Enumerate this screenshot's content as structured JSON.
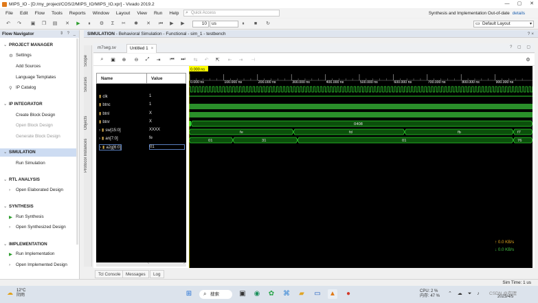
{
  "window": {
    "title": "MIPS_IO - [D:/my_project/COS/2/MIPS_IO/MIPS_IO.xpr] - Vivado 2019.2",
    "controls": [
      "—",
      "▢",
      "✕"
    ]
  },
  "menubar": {
    "items": [
      "File",
      "Edit",
      "Flow",
      "Tools",
      "Reports",
      "Window",
      "Layout",
      "View",
      "Run",
      "Help"
    ],
    "quick_access_placeholder": "Quick Access"
  },
  "status": {
    "text": "Synthesis and Implementation Out-of-date",
    "details_link": "details"
  },
  "toolbar": {
    "run_time_value": "10",
    "run_time_unit": "us",
    "layout_select": "Default Layout"
  },
  "flow_navigator": {
    "title": "Flow Navigator",
    "header_icons": "⇕ ? _",
    "sections": {
      "project_manager": "PROJECT MANAGER",
      "ip_integrator": "IP INTEGRATOR",
      "simulation": "SIMULATION",
      "rtl_analysis": "RTL ANALYSIS",
      "synthesis": "SYNTHESIS",
      "implementation": "IMPLEMENTATION"
    },
    "items": {
      "settings": "Settings",
      "add_sources": "Add Sources",
      "language_templates": "Language Templates",
      "ip_catalog": "IP Catalog",
      "create_block_design": "Create Block Design",
      "open_block_design": "Open Block Design",
      "generate_block_design": "Generate Block Design",
      "run_simulation": "Run Simulation",
      "open_elaborated_design": "Open Elaborated Design",
      "run_synthesis": "Run Synthesis",
      "open_synthesized_design": "Open Synthesized Design",
      "run_implementation": "Run Implementation",
      "open_implemented_design": "Open Implemented Design"
    }
  },
  "sim_header": {
    "label": "SIMULATION",
    "detail": "- Behavioral Simulation - Functional - sim_1 - testbench",
    "right": "? ×"
  },
  "side_tabs": [
    "Scope",
    "Sources",
    "Objects",
    "Protocol Instances"
  ],
  "editor_tabs": [
    {
      "label": "m7seg.sv",
      "active": false
    },
    {
      "label": "Untitled 1",
      "active": true
    }
  ],
  "tabstrip_right": "? ▢ ▢",
  "wave": {
    "name_header": "Name",
    "value_header": "Value",
    "cursor_label": "0.000 ns",
    "time_ticks": [
      "0.000 ns",
      "100.000 ns",
      "200.000 ns",
      "300.000 ns",
      "400.000 ns",
      "500.000 ns",
      "600.000 ns",
      "700.000 ns",
      "800.000 ns",
      "900.000 ns"
    ],
    "signals": [
      {
        "name": "clk",
        "value": "1",
        "bus": false
      },
      {
        "name": "btnc",
        "value": "1",
        "bus": false
      },
      {
        "name": "btnl",
        "value": "X",
        "bus": false
      },
      {
        "name": "btnr",
        "value": "X",
        "bus": false
      },
      {
        "name": "sw[15:0]",
        "value": "XXXX",
        "bus": true
      },
      {
        "name": "an[7:0]",
        "value": "fe",
        "bus": true
      },
      {
        "name": "a2g[6:0]",
        "value": "01",
        "bus": true
      }
    ],
    "bus_labels": {
      "sw": [
        "0408"
      ],
      "an": [
        "fe",
        "fd",
        "fb",
        "f7"
      ],
      "a2g": [
        "01",
        "31",
        "01",
        "76"
      ]
    },
    "bandwidth_in": "0.0 KB/s",
    "bandwidth_out": "0.0 KB/s"
  },
  "bottom_tabs": [
    "Tcl Console",
    "Messages",
    "Log"
  ],
  "sim_time": "Sim Time: 1 us",
  "taskbar": {
    "weather_temp": "12°C",
    "weather_desc": "阴雨",
    "search_label": "搜索",
    "cpu": "CPU: 2 %",
    "memory": "内存: 47 %",
    "watermark": "CSDN @有理",
    "date": "2023/4/5"
  },
  "colors": {
    "wave_bg": "#000000",
    "wave_green": "#2fd62f",
    "cursor": "#ffff00",
    "bus_fill": "#0b4f0b"
  }
}
